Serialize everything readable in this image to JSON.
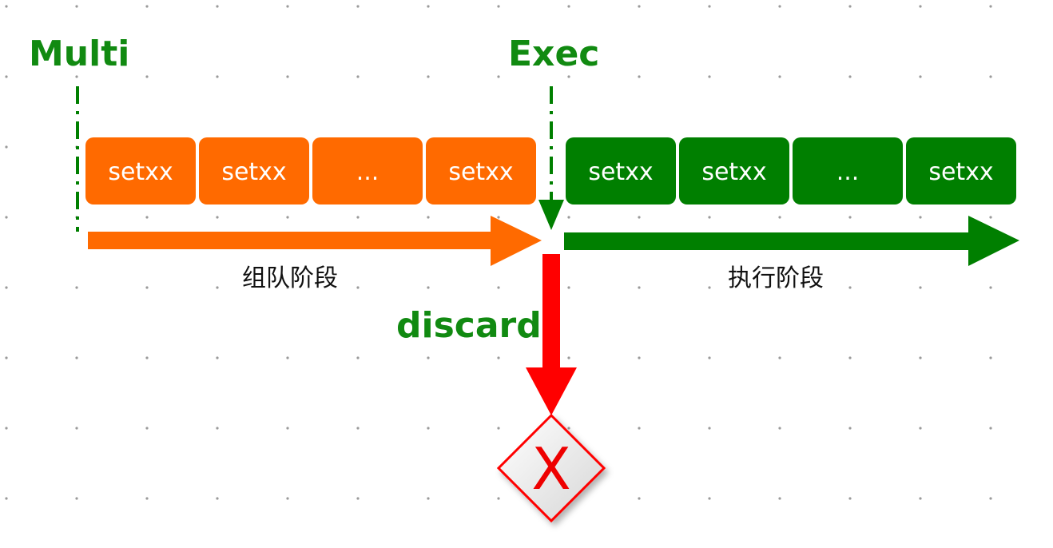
{
  "labels": {
    "multi": "Multi",
    "exec": "Exec",
    "discard": "discard"
  },
  "queue_phase": {
    "label": "组队阶段",
    "boxes": [
      "setxx",
      "setxx",
      "...",
      "setxx"
    ]
  },
  "exec_phase": {
    "label": "执行阶段",
    "boxes": [
      "setxx",
      "setxx",
      "...",
      "setxx"
    ]
  },
  "discard_result": {
    "symbol": "X"
  },
  "colors": {
    "orange": "#ff6a00",
    "green": "#007f00",
    "red": "#ff0000",
    "label_green": "#118a11"
  }
}
